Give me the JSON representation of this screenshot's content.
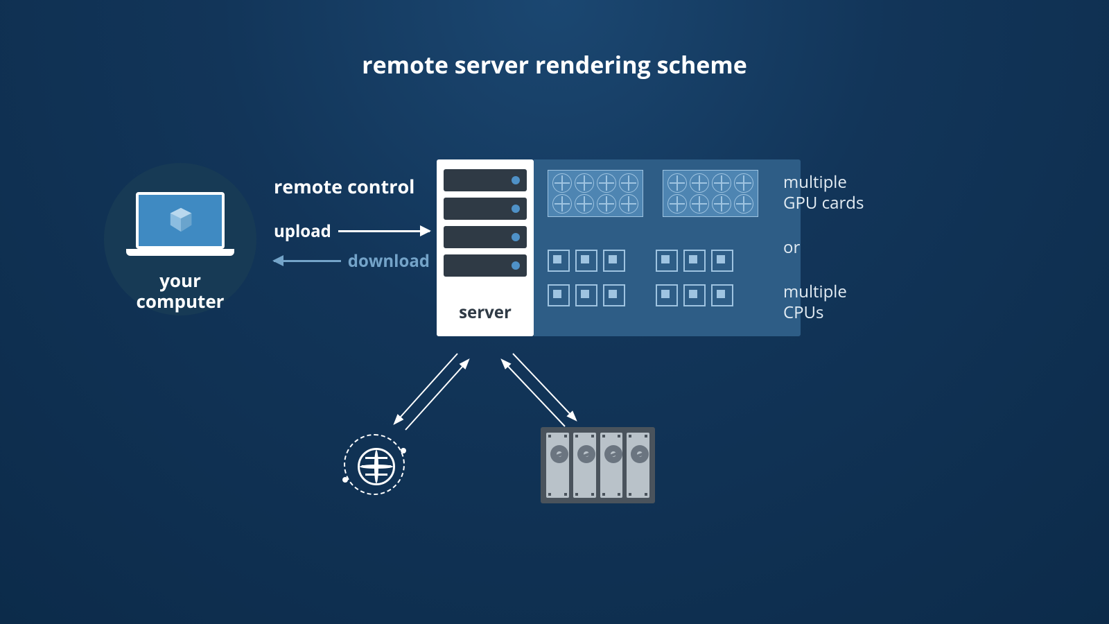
{
  "title": "remote server rendering scheme",
  "laptop": {
    "label_line1": "your",
    "label_line2": "computer"
  },
  "arrows": {
    "remote": "remote control",
    "upload": "upload",
    "download": "download"
  },
  "server": {
    "label": "server"
  },
  "side": {
    "gpu_line1": "multiple",
    "gpu_line2": "GPU cards",
    "or": "or",
    "cpu_line1": "multiple",
    "cpu_line2": "CPUs"
  },
  "icons": {
    "laptop": "laptop-icon",
    "server_tower": "server-tower-icon",
    "gpu": "gpu-card-icon",
    "cpu": "cpu-chip-icon",
    "globe": "globe-network-icon",
    "storage": "hard-drive-array-icon"
  }
}
